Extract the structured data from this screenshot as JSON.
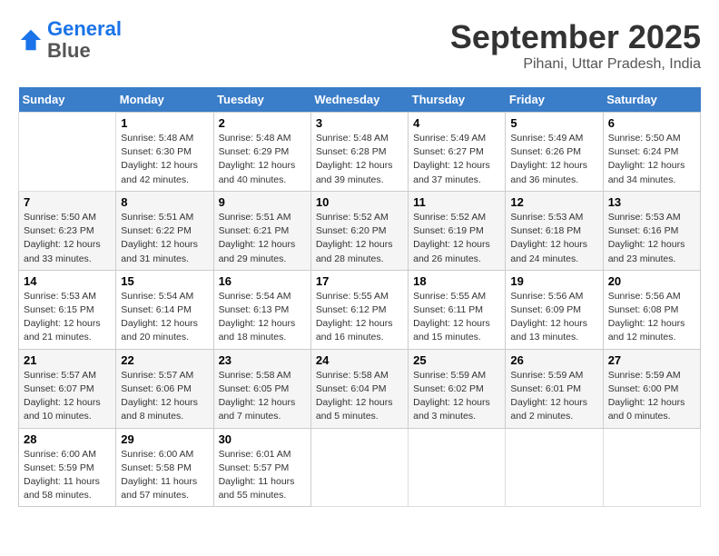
{
  "header": {
    "logo_line1": "General",
    "logo_line2": "Blue",
    "month": "September 2025",
    "location": "Pihani, Uttar Pradesh, India"
  },
  "weekdays": [
    "Sunday",
    "Monday",
    "Tuesday",
    "Wednesday",
    "Thursday",
    "Friday",
    "Saturday"
  ],
  "weeks": [
    [
      null,
      {
        "day": "1",
        "sunrise": "5:48 AM",
        "sunset": "6:30 PM",
        "daylight": "12 hours and 42 minutes."
      },
      {
        "day": "2",
        "sunrise": "5:48 AM",
        "sunset": "6:29 PM",
        "daylight": "12 hours and 40 minutes."
      },
      {
        "day": "3",
        "sunrise": "5:48 AM",
        "sunset": "6:28 PM",
        "daylight": "12 hours and 39 minutes."
      },
      {
        "day": "4",
        "sunrise": "5:49 AM",
        "sunset": "6:27 PM",
        "daylight": "12 hours and 37 minutes."
      },
      {
        "day": "5",
        "sunrise": "5:49 AM",
        "sunset": "6:26 PM",
        "daylight": "12 hours and 36 minutes."
      },
      {
        "day": "6",
        "sunrise": "5:50 AM",
        "sunset": "6:24 PM",
        "daylight": "12 hours and 34 minutes."
      }
    ],
    [
      {
        "day": "7",
        "sunrise": "5:50 AM",
        "sunset": "6:23 PM",
        "daylight": "12 hours and 33 minutes."
      },
      {
        "day": "8",
        "sunrise": "5:51 AM",
        "sunset": "6:22 PM",
        "daylight": "12 hours and 31 minutes."
      },
      {
        "day": "9",
        "sunrise": "5:51 AM",
        "sunset": "6:21 PM",
        "daylight": "12 hours and 29 minutes."
      },
      {
        "day": "10",
        "sunrise": "5:52 AM",
        "sunset": "6:20 PM",
        "daylight": "12 hours and 28 minutes."
      },
      {
        "day": "11",
        "sunrise": "5:52 AM",
        "sunset": "6:19 PM",
        "daylight": "12 hours and 26 minutes."
      },
      {
        "day": "12",
        "sunrise": "5:53 AM",
        "sunset": "6:18 PM",
        "daylight": "12 hours and 24 minutes."
      },
      {
        "day": "13",
        "sunrise": "5:53 AM",
        "sunset": "6:16 PM",
        "daylight": "12 hours and 23 minutes."
      }
    ],
    [
      {
        "day": "14",
        "sunrise": "5:53 AM",
        "sunset": "6:15 PM",
        "daylight": "12 hours and 21 minutes."
      },
      {
        "day": "15",
        "sunrise": "5:54 AM",
        "sunset": "6:14 PM",
        "daylight": "12 hours and 20 minutes."
      },
      {
        "day": "16",
        "sunrise": "5:54 AM",
        "sunset": "6:13 PM",
        "daylight": "12 hours and 18 minutes."
      },
      {
        "day": "17",
        "sunrise": "5:55 AM",
        "sunset": "6:12 PM",
        "daylight": "12 hours and 16 minutes."
      },
      {
        "day": "18",
        "sunrise": "5:55 AM",
        "sunset": "6:11 PM",
        "daylight": "12 hours and 15 minutes."
      },
      {
        "day": "19",
        "sunrise": "5:56 AM",
        "sunset": "6:09 PM",
        "daylight": "12 hours and 13 minutes."
      },
      {
        "day": "20",
        "sunrise": "5:56 AM",
        "sunset": "6:08 PM",
        "daylight": "12 hours and 12 minutes."
      }
    ],
    [
      {
        "day": "21",
        "sunrise": "5:57 AM",
        "sunset": "6:07 PM",
        "daylight": "12 hours and 10 minutes."
      },
      {
        "day": "22",
        "sunrise": "5:57 AM",
        "sunset": "6:06 PM",
        "daylight": "12 hours and 8 minutes."
      },
      {
        "day": "23",
        "sunrise": "5:58 AM",
        "sunset": "6:05 PM",
        "daylight": "12 hours and 7 minutes."
      },
      {
        "day": "24",
        "sunrise": "5:58 AM",
        "sunset": "6:04 PM",
        "daylight": "12 hours and 5 minutes."
      },
      {
        "day": "25",
        "sunrise": "5:59 AM",
        "sunset": "6:02 PM",
        "daylight": "12 hours and 3 minutes."
      },
      {
        "day": "26",
        "sunrise": "5:59 AM",
        "sunset": "6:01 PM",
        "daylight": "12 hours and 2 minutes."
      },
      {
        "day": "27",
        "sunrise": "5:59 AM",
        "sunset": "6:00 PM",
        "daylight": "12 hours and 0 minutes."
      }
    ],
    [
      {
        "day": "28",
        "sunrise": "6:00 AM",
        "sunset": "5:59 PM",
        "daylight": "11 hours and 58 minutes."
      },
      {
        "day": "29",
        "sunrise": "6:00 AM",
        "sunset": "5:58 PM",
        "daylight": "11 hours and 57 minutes."
      },
      {
        "day": "30",
        "sunrise": "6:01 AM",
        "sunset": "5:57 PM",
        "daylight": "11 hours and 55 minutes."
      },
      null,
      null,
      null,
      null
    ]
  ]
}
